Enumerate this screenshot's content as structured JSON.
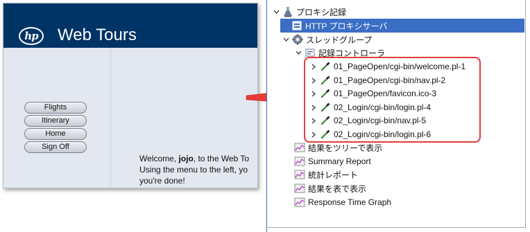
{
  "webtours": {
    "logo_text": "hp",
    "title": "Web Tours",
    "nav": [
      "Flights",
      "Itinerary",
      "Home",
      "Sign Off"
    ],
    "welcome_prefix": "Welcome, ",
    "welcome_user": "jojo",
    "welcome_suffix": ", to the Web To",
    "line2": "Using the menu to the left, yo",
    "line3": "you're done!"
  },
  "tree": {
    "proxy_recorder": "プロキシ記録",
    "http_proxy_server": "HTTP プロキシサーバ",
    "thread_group": "スレッドグループ",
    "recording_controller": "記録コントローラ",
    "samplers": [
      "01_PageOpen/cgi-bin/welcome.pl-1",
      "01_PageOpen/cgi-bin/nav.pl-2",
      "01_PageOpen/favicon.ico-3",
      "02_Login/cgi-bin/login.pl-4",
      "02_Login/cgi-bin/nav.pl-5",
      "02_Login/cgi-bin/login.pl-6"
    ],
    "listeners": [
      "結果をツリーで表示",
      "Summary Report",
      "統計レポート",
      "結果を表で表示",
      "Response Time Graph"
    ]
  },
  "colors": {
    "header_navy": "#003466",
    "selected_row": "#3b6ec5",
    "highlight_red": "#e23b3b",
    "panel_bg": "#e3e7ef"
  },
  "icons": {
    "sampler": "pipette-icon",
    "listener": "graph-icon",
    "thread_group": "gear-icon",
    "proxy": "flask-icon"
  }
}
